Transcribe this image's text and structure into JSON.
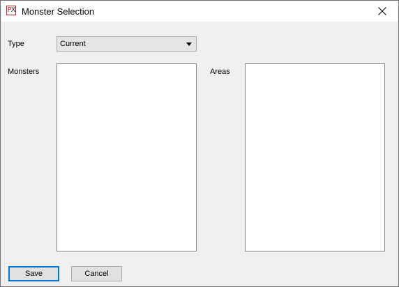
{
  "window": {
    "title": "Monster Selection",
    "icon": "px-app-icon"
  },
  "form": {
    "type_label": "Type",
    "type_value": "Current",
    "monsters_label": "Monsters",
    "areas_label": "Areas",
    "monsters_items": [],
    "areas_items": []
  },
  "buttons": {
    "save_label": "Save",
    "cancel_label": "Cancel"
  },
  "colors": {
    "default_button_border": "#0078d7",
    "dialog_background": "#f0f0f0"
  }
}
